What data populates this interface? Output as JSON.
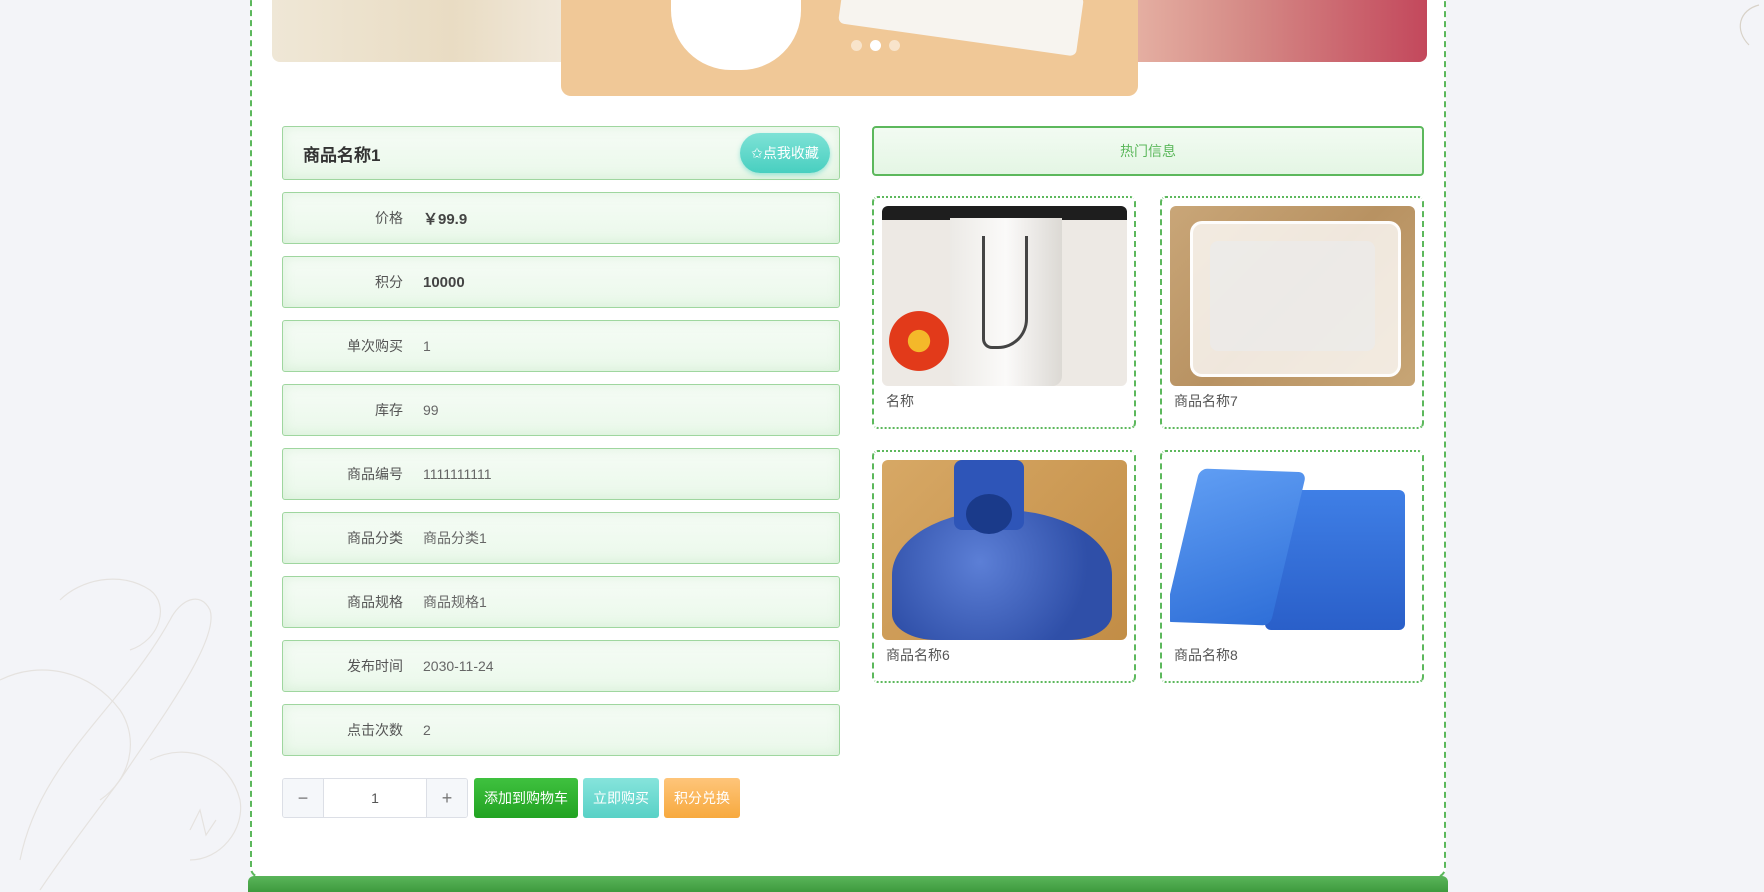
{
  "carousel": {
    "dots": 3,
    "active_dot": 2
  },
  "product": {
    "title": "商品名称1",
    "favorite_label": "✩点我收藏",
    "rows": [
      {
        "label": "价格",
        "value": "￥99.9",
        "bold": true
      },
      {
        "label": "积分",
        "value": "10000",
        "bold": true
      },
      {
        "label": "单次购买",
        "value": "1",
        "bold": false
      },
      {
        "label": "库存",
        "value": "99",
        "bold": false
      },
      {
        "label": "商品编号",
        "value": "1111111111",
        "bold": false
      },
      {
        "label": "商品分类",
        "value": "商品分类1",
        "bold": false
      },
      {
        "label": "商品规格",
        "value": "商品规格1",
        "bold": false
      },
      {
        "label": "发布时间",
        "value": "2030-11-24",
        "bold": false
      },
      {
        "label": "点击次数",
        "value": "2",
        "bold": false
      }
    ]
  },
  "actions": {
    "quantity": "1",
    "minus_symbol": "−",
    "plus_symbol": "+",
    "add_to_cart": "添加到购物车",
    "buy_now": "立即购买",
    "points_exchange": "积分兑换"
  },
  "hot": {
    "title": "热门信息",
    "items": [
      {
        "name": "名称",
        "image": "paper-cup-image"
      },
      {
        "name": "商品名称7",
        "image": "plastic-tray-image"
      },
      {
        "name": "商品名称6",
        "image": "blue-pellets-image"
      },
      {
        "name": "商品名称8",
        "image": "blue-crate-image"
      }
    ]
  },
  "colors": {
    "accent_green": "#5cb85c",
    "teal": "#48cfc0",
    "orange": "#f7a93e"
  }
}
